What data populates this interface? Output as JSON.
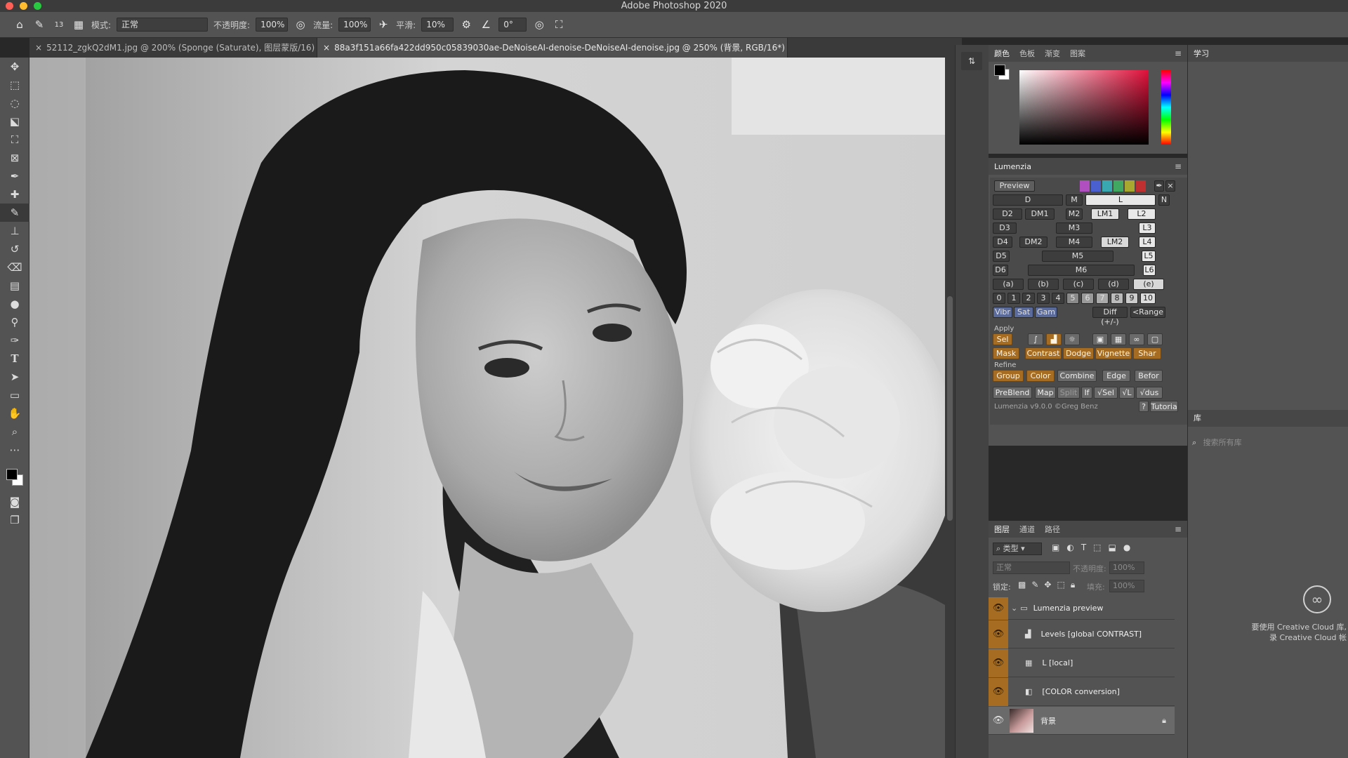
{
  "app": {
    "title": "Adobe Photoshop 2020"
  },
  "traffic_colors": {
    "close": "#fe5f57",
    "min": "#febc2e",
    "max": "#28c840"
  },
  "options": {
    "brush_size": "13",
    "mode_label": "模式:",
    "mode_value": "正常",
    "opacity_label": "不透明度:",
    "opacity_value": "100%",
    "flow_label": "流量:",
    "flow_value": "100%",
    "smoothing_label": "平滑:",
    "smoothing_value": "10%",
    "angle_value": "0°"
  },
  "tabs": [
    {
      "label": "52112_zgkQ2dM1.jpg @ 200% (Sponge (Saturate), 图层蒙版/16) *"
    },
    {
      "label": "88a3f151a66fa422dd950c05839030ae-DeNoiseAI-denoise-DeNoiseAI-denoise.jpg @ 250% (背景, RGB/16*) *"
    }
  ],
  "color_panel": {
    "tabs": [
      "颜色",
      "色板",
      "渐变",
      "图案"
    ],
    "fg": "#000000",
    "bg": "#ffffff",
    "hue": "#e0103a"
  },
  "lumenzia": {
    "title": "Lumenzia",
    "preview": "Preview",
    "swatches": [
      "#b050c0",
      "#4a5fd0",
      "#3aa8b0",
      "#40a860",
      "#a8a830",
      "#c03030"
    ],
    "zone_rows": [
      [
        "D",
        "M",
        "L"
      ],
      [
        "D2",
        "DM1",
        "M2",
        "LM1",
        "L2"
      ],
      [
        "D3",
        "M3",
        "L3"
      ],
      [
        "D4",
        "DM2",
        "M4",
        "LM2",
        "L4"
      ],
      [
        "D5",
        "M5",
        "L5"
      ],
      [
        "D6",
        "M6",
        "L6"
      ]
    ],
    "letters": [
      "(a)",
      "(b)",
      "(c)",
      "(d)",
      "(e)"
    ],
    "numbers": [
      "0",
      "1",
      "2",
      "3",
      "4",
      "5",
      "6",
      "7",
      "8",
      "9",
      "10"
    ],
    "vsg": [
      "Vibr",
      "Sat",
      "Gam"
    ],
    "diff": "Diff (+/-)",
    "range": "<Range",
    "apply_label": "Apply",
    "sel": "Sel",
    "apply_row": [
      "Mask",
      "Contrast",
      "Dodge",
      "Vignette",
      "Shar"
    ],
    "refine_label": "Refine",
    "refine_row": [
      "Group",
      "Color",
      "Combine",
      "Edge",
      "Befor"
    ],
    "util_row": [
      "PreBlend",
      "Map",
      "Split",
      "If",
      "√Sel",
      "√L",
      "√dus"
    ],
    "version": "Lumenzia v9.0.0 ©Greg Benz",
    "help": "?",
    "tutorial": "Tutoria",
    "nlabel": "N"
  },
  "layers_panel": {
    "tabs": [
      "图层",
      "通道",
      "路径"
    ],
    "filter": "类型",
    "blend": "正常",
    "opacity_label": "不透明度:",
    "opacity_value": "100%",
    "lock_label": "锁定:",
    "fill_label": "填充:",
    "fill_value": "100%",
    "layers": [
      {
        "name": "Lumenzia preview",
        "kind": "group"
      },
      {
        "name": "Levels [global CONTRAST]",
        "kind": "levels"
      },
      {
        "name": "L [local]",
        "kind": "curves"
      },
      {
        "name": "[COLOR conversion]",
        "kind": "bw"
      },
      {
        "name": "背景",
        "kind": "image"
      }
    ]
  },
  "learn": {
    "tab": "学习"
  },
  "library": {
    "tab": "库",
    "search_placeholder": "搜索所有库",
    "cc_line1": "要使用 Creative Cloud 库,",
    "cc_line2": "录 Creative Cloud 帐"
  }
}
